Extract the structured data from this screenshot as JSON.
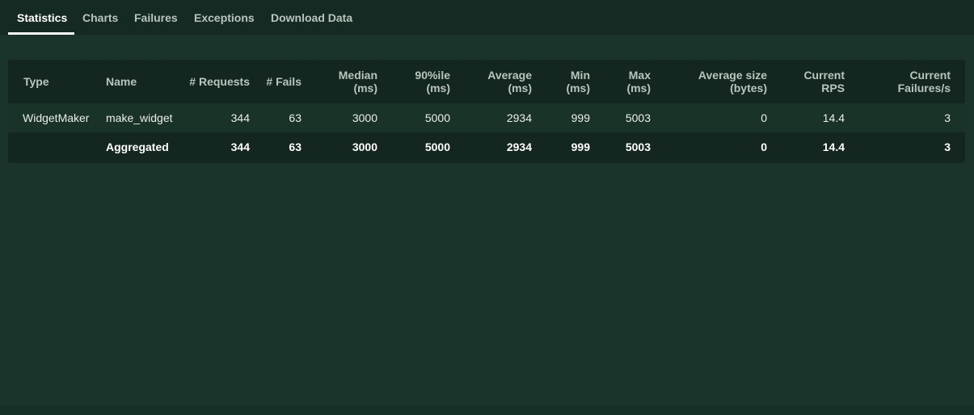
{
  "tabs": [
    {
      "label": "Statistics",
      "active": true
    },
    {
      "label": "Charts",
      "active": false
    },
    {
      "label": "Failures",
      "active": false
    },
    {
      "label": "Exceptions",
      "active": false
    },
    {
      "label": "Download Data",
      "active": false
    }
  ],
  "table": {
    "columns": [
      {
        "line1": "Type",
        "line2": ""
      },
      {
        "line1": "Name",
        "line2": ""
      },
      {
        "line1": "# Requests",
        "line2": ""
      },
      {
        "line1": "# Fails",
        "line2": ""
      },
      {
        "line1": "Median",
        "line2": "(ms)"
      },
      {
        "line1": "90%ile",
        "line2": "(ms)"
      },
      {
        "line1": "Average",
        "line2": "(ms)"
      },
      {
        "line1": "Min",
        "line2": "(ms)"
      },
      {
        "line1": "Max",
        "line2": "(ms)"
      },
      {
        "line1": "Average size",
        "line2": "(bytes)"
      },
      {
        "line1": "Current",
        "line2": "RPS"
      },
      {
        "line1": "Current",
        "line2": "Failures/s"
      }
    ],
    "rows": [
      [
        "WidgetMaker",
        "make_widget",
        "344",
        "63",
        "3000",
        "5000",
        "2934",
        "999",
        "5003",
        "0",
        "14.4",
        "3"
      ]
    ],
    "aggregated": [
      "",
      "Aggregated",
      "344",
      "63",
      "3000",
      "5000",
      "2934",
      "999",
      "5003",
      "0",
      "14.4",
      "3"
    ]
  },
  "colors": {
    "background": "#1b342b",
    "tabbar": "#152a23",
    "panel": "#132720",
    "row": "#1a3329",
    "header_text": "#b7c5bd",
    "text": "#ffffff"
  }
}
